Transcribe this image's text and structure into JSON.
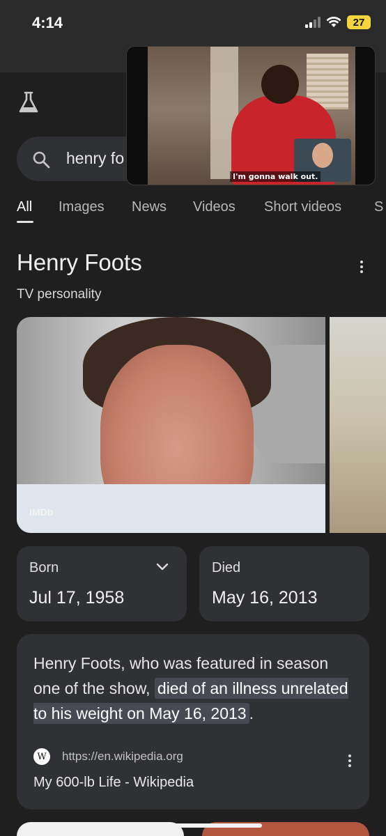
{
  "status_bar": {
    "time": "4:14",
    "battery": "27"
  },
  "search": {
    "query": "henry fo"
  },
  "pip": {
    "caption": "I'm gonna walk out."
  },
  "tabs": [
    {
      "label": "All",
      "active": true
    },
    {
      "label": "Images",
      "active": false
    },
    {
      "label": "News",
      "active": false
    },
    {
      "label": "Videos",
      "active": false
    },
    {
      "label": "Short videos",
      "active": false
    },
    {
      "label": "S",
      "active": false
    }
  ],
  "knowledge_panel": {
    "title": "Henry Foots",
    "subtitle": "TV personality",
    "image_source": "IMDb"
  },
  "facts": {
    "born_label": "Born",
    "born_value": "Jul 17, 1958",
    "died_label": "Died",
    "died_value": "May 16, 2013"
  },
  "snippet": {
    "text_before": "Henry Foots, who was featured in season one of the show, ",
    "highlight": "died of an illness unrelated to his weight on May 16, 2013",
    "text_after": ".",
    "source_icon": "W",
    "source_url": "https://en.wikipedia.org",
    "source_title": "My 600-lb Life - Wikipedia"
  },
  "colors": {
    "background": "#1f1f1f",
    "card": "#303134",
    "battery": "#f2d53c"
  }
}
